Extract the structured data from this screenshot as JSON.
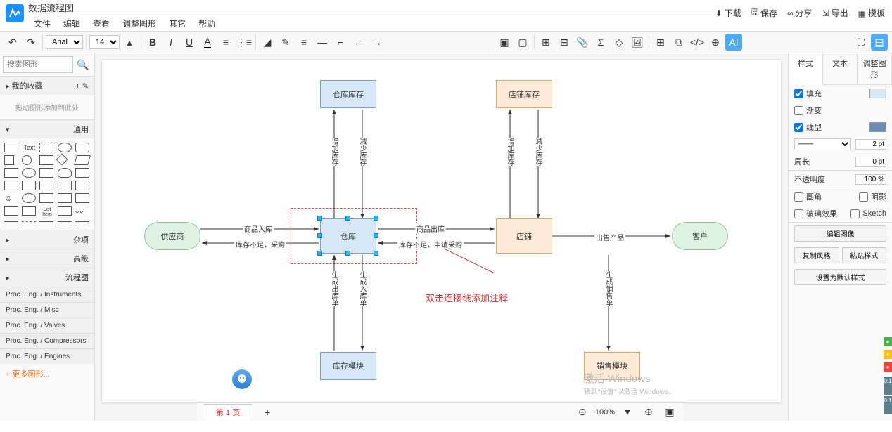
{
  "title": "数据流程图",
  "menus": [
    "文件",
    "编辑",
    "查看",
    "调整图形",
    "其它",
    "帮助"
  ],
  "topRight": [
    {
      "icon": "download",
      "label": "下载"
    },
    {
      "icon": "save",
      "label": "保存"
    },
    {
      "icon": "share",
      "label": "分享"
    },
    {
      "icon": "export",
      "label": "导出"
    },
    {
      "icon": "template",
      "label": "模板"
    }
  ],
  "toolbar": {
    "font": "Arial",
    "fontSize": "14"
  },
  "search": {
    "placeholder": "搜索图形"
  },
  "palette": {
    "favorites": {
      "title": "我的收藏",
      "empty": "拖动图形添加到此处"
    },
    "general": {
      "title": "通用"
    },
    "misc": {
      "title": "杂项"
    },
    "advanced": {
      "title": "高级"
    },
    "flowchart": {
      "title": "流程图"
    },
    "pe_instruments": "Proc. Eng. / Instruments",
    "pe_misc": "Proc. Eng. / Misc",
    "pe_valves": "Proc. Eng. / Valves",
    "pe_compressors": "Proc. Eng. / Compressors",
    "pe_engines": "Proc. Eng. / Engines",
    "more": "+ 更多图形..."
  },
  "nodes": {
    "warehouse_stock": "仓库库存",
    "store_stock": "店铺库存",
    "supplier": "供应商",
    "warehouse": "仓库",
    "store": "店铺",
    "customer": "客户",
    "stock_module": "库存模块",
    "sales_module": "销售模块"
  },
  "edges": {
    "inc_stock": "增加库存",
    "dec_stock": "减少库存",
    "goods_in": "商品入库",
    "goods_out": "商品出库",
    "short_purchase": "库存不足，采购",
    "short_apply": "库存不足，申请采购",
    "gen_out": "生成出库单",
    "gen_in": "生成入库单",
    "sell_product": "出售产品",
    "gen_sales": "生成销售单"
  },
  "annotation": "双击连接线添加注释",
  "rightPanel": {
    "tabs": [
      "样式",
      "文本",
      "调整图形"
    ],
    "fill": "填充",
    "gradient": "渐变",
    "line": "线型",
    "lineWidth": "2 pt",
    "perimeter": "周长",
    "perimeterVal": "0 pt",
    "opacity": "不透明度",
    "opacityVal": "100 %",
    "rounded": "圆角",
    "shadow": "阴影",
    "glass": "玻璃效果",
    "sketch": "Sketch",
    "editImage": "编辑图像",
    "copyStyle": "复制风格",
    "pasteStyle": "粘贴样式",
    "setDefault": "设置为默认样式"
  },
  "status": {
    "page": "第 1 页",
    "zoom": "100%"
  },
  "watermark": {
    "line1": "激活 Windows",
    "line2": "转到\"设置\"以激活 Windows。"
  }
}
